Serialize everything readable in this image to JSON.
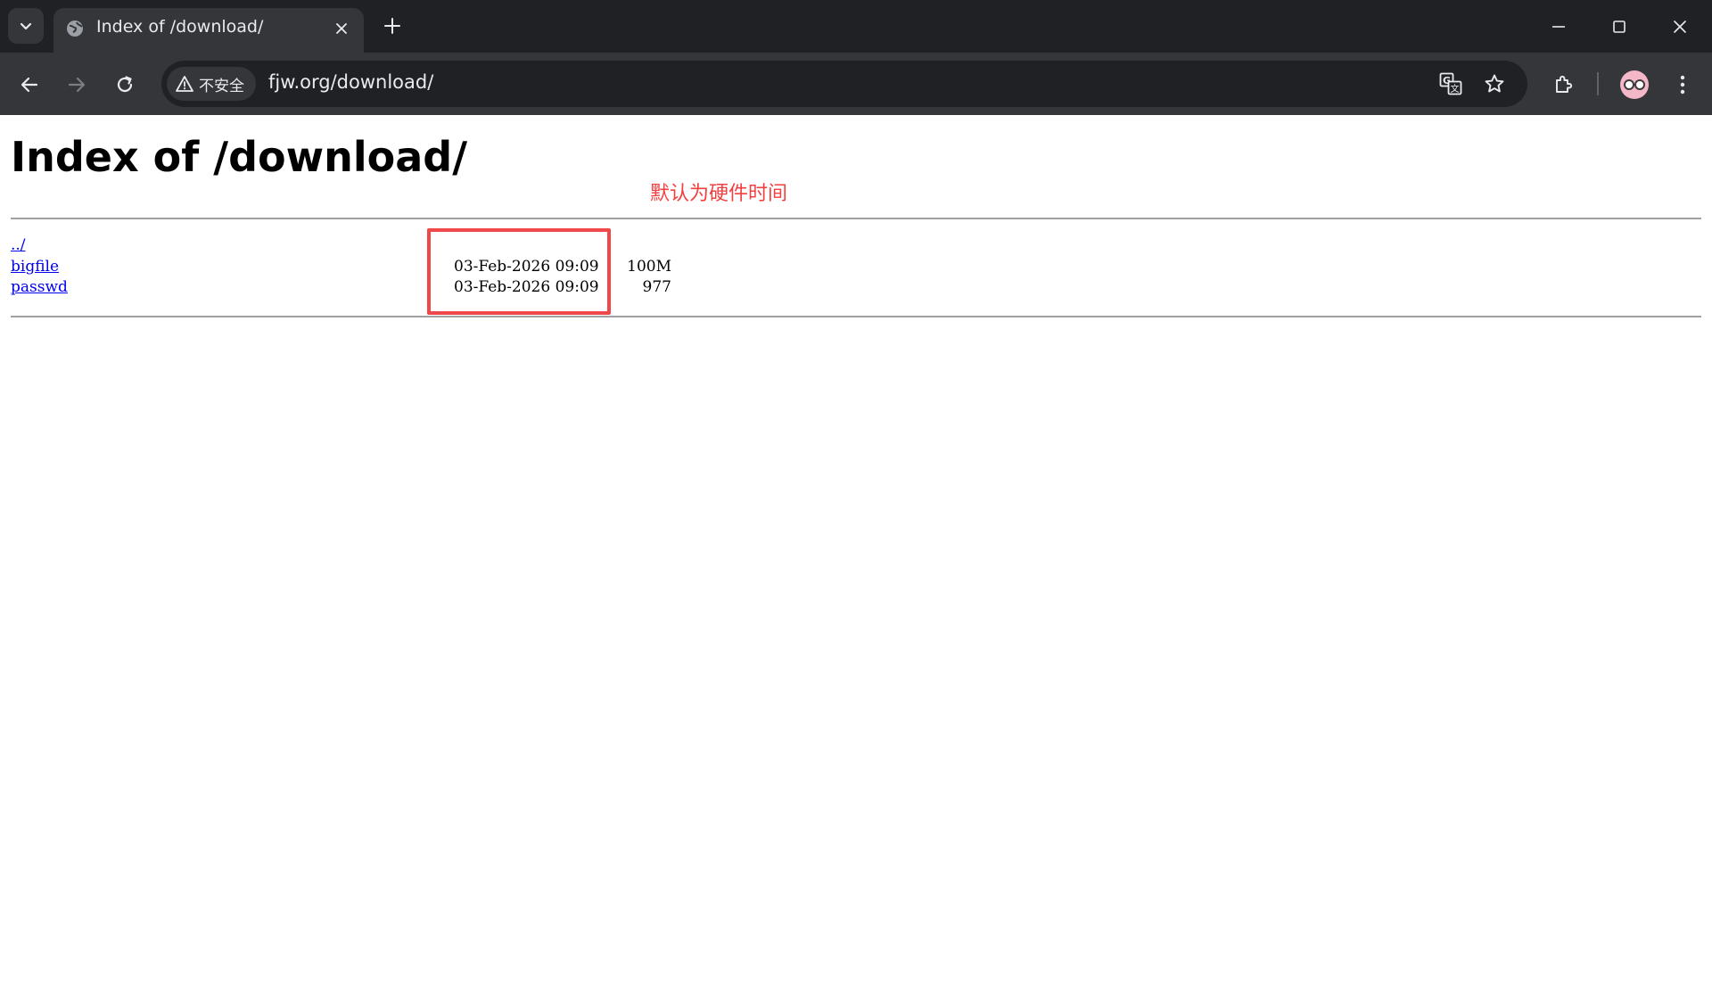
{
  "browser": {
    "tab_title": "Index of /download/",
    "security_label": "不安全",
    "url": "fjw.org/download/"
  },
  "page": {
    "title": "Index of /download/",
    "annotation": "默认为硬件时间",
    "entries": [
      {
        "name": "../",
        "mtime": "",
        "size": ""
      },
      {
        "name": "bigfile",
        "mtime": "03-Feb-2026 09:09",
        "size": "100M"
      },
      {
        "name": "passwd",
        "mtime": "03-Feb-2026 09:09",
        "size": "977"
      }
    ]
  },
  "colors": {
    "chrome_dark": "#202124",
    "chrome_toolbar": "#35363a",
    "link": "#0000ee",
    "annotation_red": "#f04040"
  },
  "icons": [
    "tab-search-icon",
    "globe-icon",
    "close-icon",
    "plus-icon",
    "minimize-icon",
    "maximize-icon",
    "window-close-icon",
    "back-arrow-icon",
    "forward-arrow-icon",
    "reload-icon",
    "warning-triangle-icon",
    "translate-icon",
    "star-icon",
    "extensions-puzzle-icon",
    "profile-avatar-icon",
    "more-vert-icon"
  ]
}
